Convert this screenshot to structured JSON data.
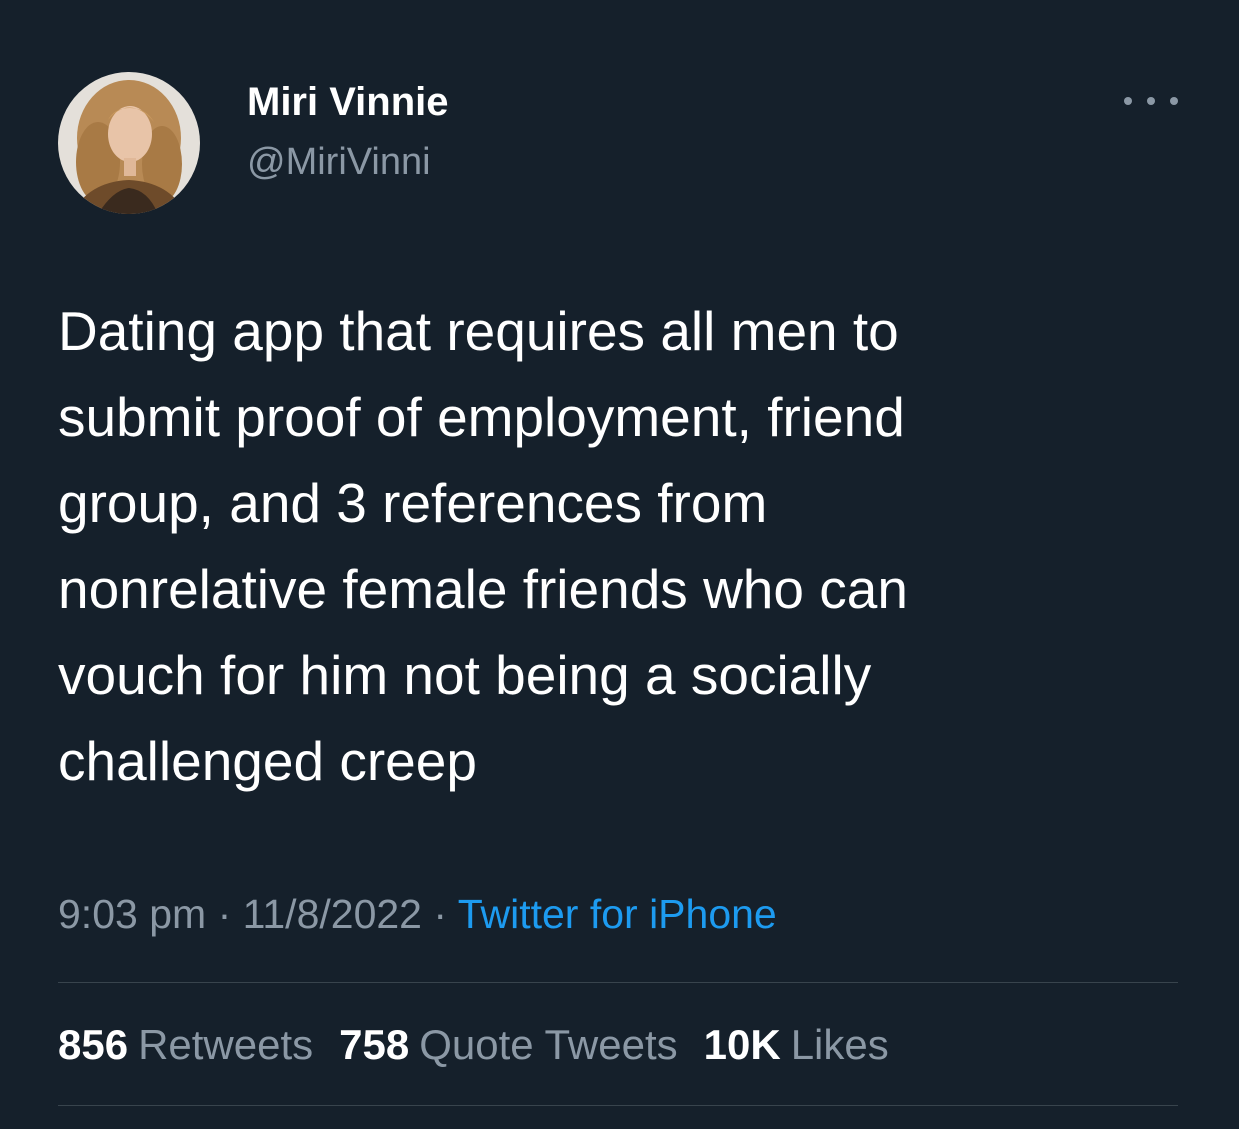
{
  "user": {
    "name": "Miri Vinnie",
    "handle": "@MiriVinni",
    "avatar_icon": "user-avatar-photo"
  },
  "menu": {
    "icon": "more-options-icon"
  },
  "tweet": {
    "text": "Dating app that requires all men to\nsubmit proof of employment, friend\ngroup, and 3 references from\nnonrelative female friends who can\nvouch for him not being a socially\nchallenged creep",
    "time": "9:03 pm",
    "date": "11/8/2022",
    "separator": "·",
    "source": "Twitter for iPhone"
  },
  "stats": {
    "retweets_count": "856",
    "retweets_label": "Retweets",
    "quotes_count": "758",
    "quotes_label": "Quote Tweets",
    "likes_count": "10K",
    "likes_label": "Likes"
  },
  "colors": {
    "background": "#15202b",
    "primary_text": "#ffffff",
    "secondary_text": "#8b98a5",
    "link": "#1d9bf0",
    "divider": "#38444d"
  }
}
